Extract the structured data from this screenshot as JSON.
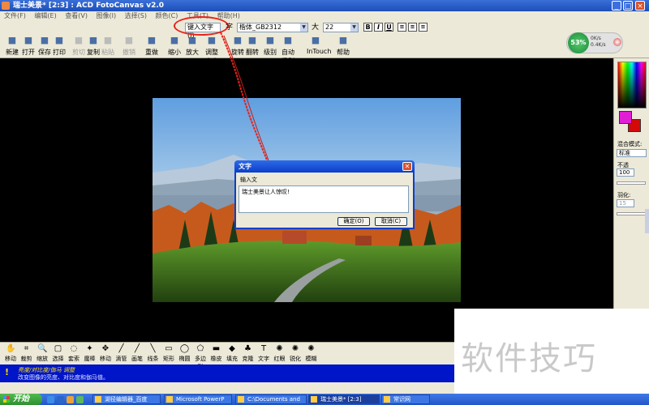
{
  "window": {
    "title": "瑞士美景* [2:3] : ACD FotoCanvas v2.0",
    "controls": [
      "_",
      "□",
      "×"
    ]
  },
  "menu": [
    "文件(F)",
    "编辑(E)",
    "查看(V)",
    "图像(I)",
    "选择(S)",
    "颜色(C)",
    "工具(T)",
    "帮助(H)"
  ],
  "toolbar": {
    "buttons": [
      {
        "label": "新建",
        "icon": "new-file-icon"
      },
      {
        "label": "打开",
        "icon": "open-folder-icon"
      },
      {
        "label": "保存",
        "icon": "save-icon"
      },
      {
        "label": "打印",
        "icon": "print-icon"
      },
      {
        "label": "剪切",
        "icon": "cut-icon",
        "disabled": true
      },
      {
        "label": "复制",
        "icon": "copy-icon"
      },
      {
        "label": "粘贴",
        "icon": "paste-icon",
        "disabled": true
      },
      {
        "label": "撤销",
        "icon": "undo-icon",
        "disabled": true
      },
      {
        "label": "重做",
        "icon": "redo-icon"
      },
      {
        "label": "缩小",
        "icon": "zoom-out-icon"
      },
      {
        "label": "放大",
        "icon": "zoom-in-icon"
      },
      {
        "label": "调整大小",
        "icon": "resize-icon"
      },
      {
        "label": "旋转",
        "icon": "rotate-icon"
      },
      {
        "label": "翻转",
        "icon": "flip-icon"
      },
      {
        "label": "级别",
        "icon": "levels-icon"
      },
      {
        "label": "自动级别",
        "icon": "auto-levels-icon"
      },
      {
        "label": "InTouch",
        "icon": "intouch-icon"
      },
      {
        "label": "帮助",
        "icon": "help-book-icon"
      }
    ],
    "text_button": "键入文字(I)",
    "font_label": "字",
    "font_value": "楷体_GB2312",
    "size_label": "大",
    "size_value": "22",
    "format": [
      "B",
      "I",
      "U"
    ]
  },
  "net_widget": {
    "percent": "53%",
    "upload": "0K/s",
    "download": "0.4K/s"
  },
  "right_panel": {
    "blend_label": "混合模式:",
    "blend_value": "标准",
    "opacity_label": "不透",
    "opacity_value": "100",
    "feather_label": "羽化:",
    "feather_value": "15"
  },
  "dialog": {
    "title": "文字",
    "prompt": "输入文",
    "text": "瑞士美景让人惊叹!",
    "ok": "确定(O)",
    "cancel": "取消(C)"
  },
  "tools": [
    {
      "label": "移动",
      "icon": "hand-icon"
    },
    {
      "label": "裁剪",
      "icon": "crop-icon"
    },
    {
      "label": "缩放",
      "icon": "magnifier-icon"
    },
    {
      "label": "选择",
      "icon": "select-rect-icon"
    },
    {
      "label": "套索",
      "icon": "lasso-icon"
    },
    {
      "label": "魔棒",
      "icon": "magic-wand-icon"
    },
    {
      "label": "移动",
      "icon": "move-arrows-icon"
    },
    {
      "label": "滴管",
      "icon": "eyedropper-icon"
    },
    {
      "label": "画笔",
      "icon": "brush-icon"
    },
    {
      "label": "线条",
      "icon": "line-icon"
    },
    {
      "label": "矩形",
      "icon": "rectangle-icon"
    },
    {
      "label": "椭圆",
      "icon": "ellipse-icon"
    },
    {
      "label": "多边形",
      "icon": "polygon-icon"
    },
    {
      "label": "橡皮",
      "icon": "eraser-icon"
    },
    {
      "label": "填充",
      "icon": "fill-bucket-icon"
    },
    {
      "label": "克隆",
      "icon": "clone-stamp-icon"
    },
    {
      "label": "文字",
      "icon": "text-tool-icon"
    },
    {
      "label": "红眼",
      "icon": "red-eye-icon"
    },
    {
      "label": "锐化",
      "icon": "sharpen-icon"
    },
    {
      "label": "模糊",
      "icon": "blur-icon"
    }
  ],
  "status": {
    "line1": "亮度/对比度/伽马 调整",
    "line2": "改变图像的亮度、对比度和伽马值。"
  },
  "watermark": "软件技巧",
  "taskbar": {
    "start": "开始",
    "items": [
      "湖径编辑器_百度",
      "Microsoft PowerP",
      "C:\\Documents and",
      "瑞士美景* [2:3]",
      "常识网"
    ]
  }
}
